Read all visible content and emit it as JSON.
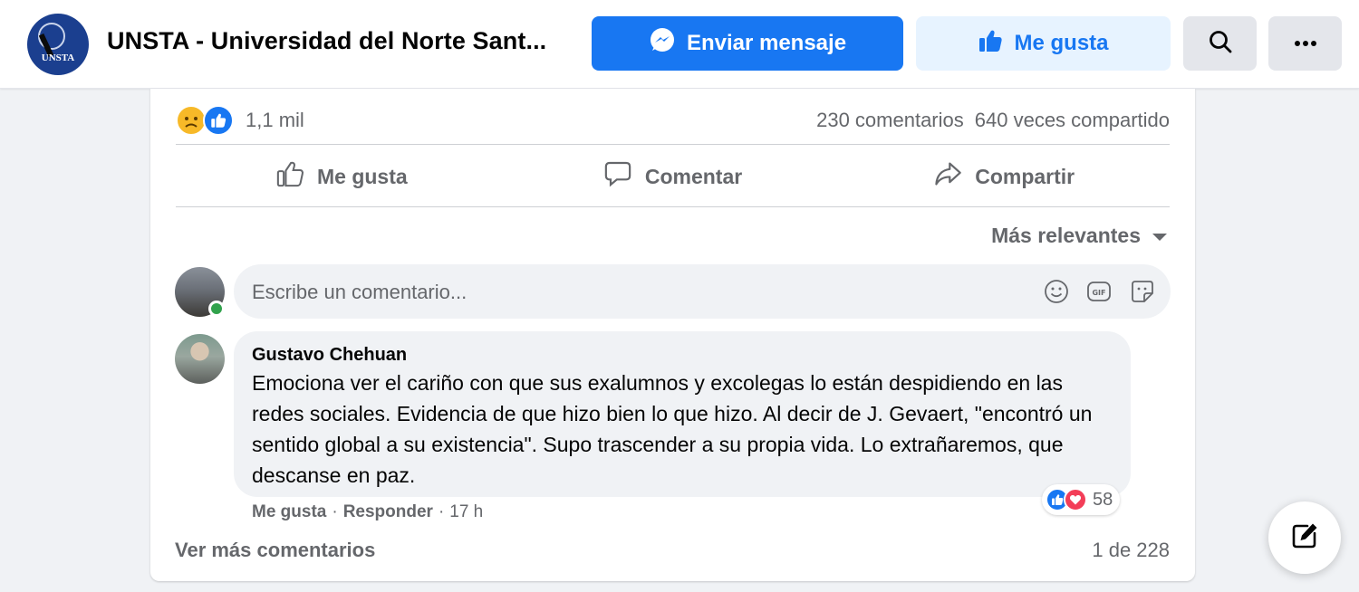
{
  "header": {
    "page_name": "UNSTA - Universidad del Norte Sant...",
    "logo_text": "UNSTA",
    "send_message_label": "Enviar mensaje",
    "like_label": "Me gusta"
  },
  "post": {
    "reaction_count": "1,1 mil",
    "comments_count": "230 comentarios",
    "shares_count": "640 veces compartido",
    "actions": {
      "like": "Me gusta",
      "comment": "Comentar",
      "share": "Compartir"
    },
    "sort_label": "Más relevantes",
    "comment_placeholder": "Escribe un comentario..."
  },
  "comment": {
    "author": "Gustavo Chehuan",
    "text": "Emociona ver el cariño con que sus exalumnos y excolegas lo están despidiendo en las redes sociales. Evidencia de que hizo bien lo que hizo. Al decir de J. Gevaert, \"encontró un sentido global a su existencia\". Supo trascender a su propia vida. Lo extrañaremos, que descanse en paz.",
    "reactions": "58",
    "like_label": "Me gusta",
    "reply_label": "Responder",
    "separator": "·",
    "time": "17 h"
  },
  "footer": {
    "more_comments": "Ver más comentarios",
    "pager": "1 de 228"
  },
  "colors": {
    "brand_blue": "#1877f2",
    "light_blue": "#e7f3ff",
    "gray_text": "#65676b",
    "input_bg": "#f0f2f5",
    "online_green": "#31a24c",
    "love_red": "#f33e58",
    "sad_yellow": "#f7b928"
  },
  "icons": [
    "messenger-icon",
    "thumbs-up-icon",
    "search-icon",
    "more-icon",
    "comment-icon",
    "share-icon",
    "caret-down-icon",
    "emoji-icon",
    "gif-icon",
    "sticker-icon",
    "compose-icon"
  ]
}
